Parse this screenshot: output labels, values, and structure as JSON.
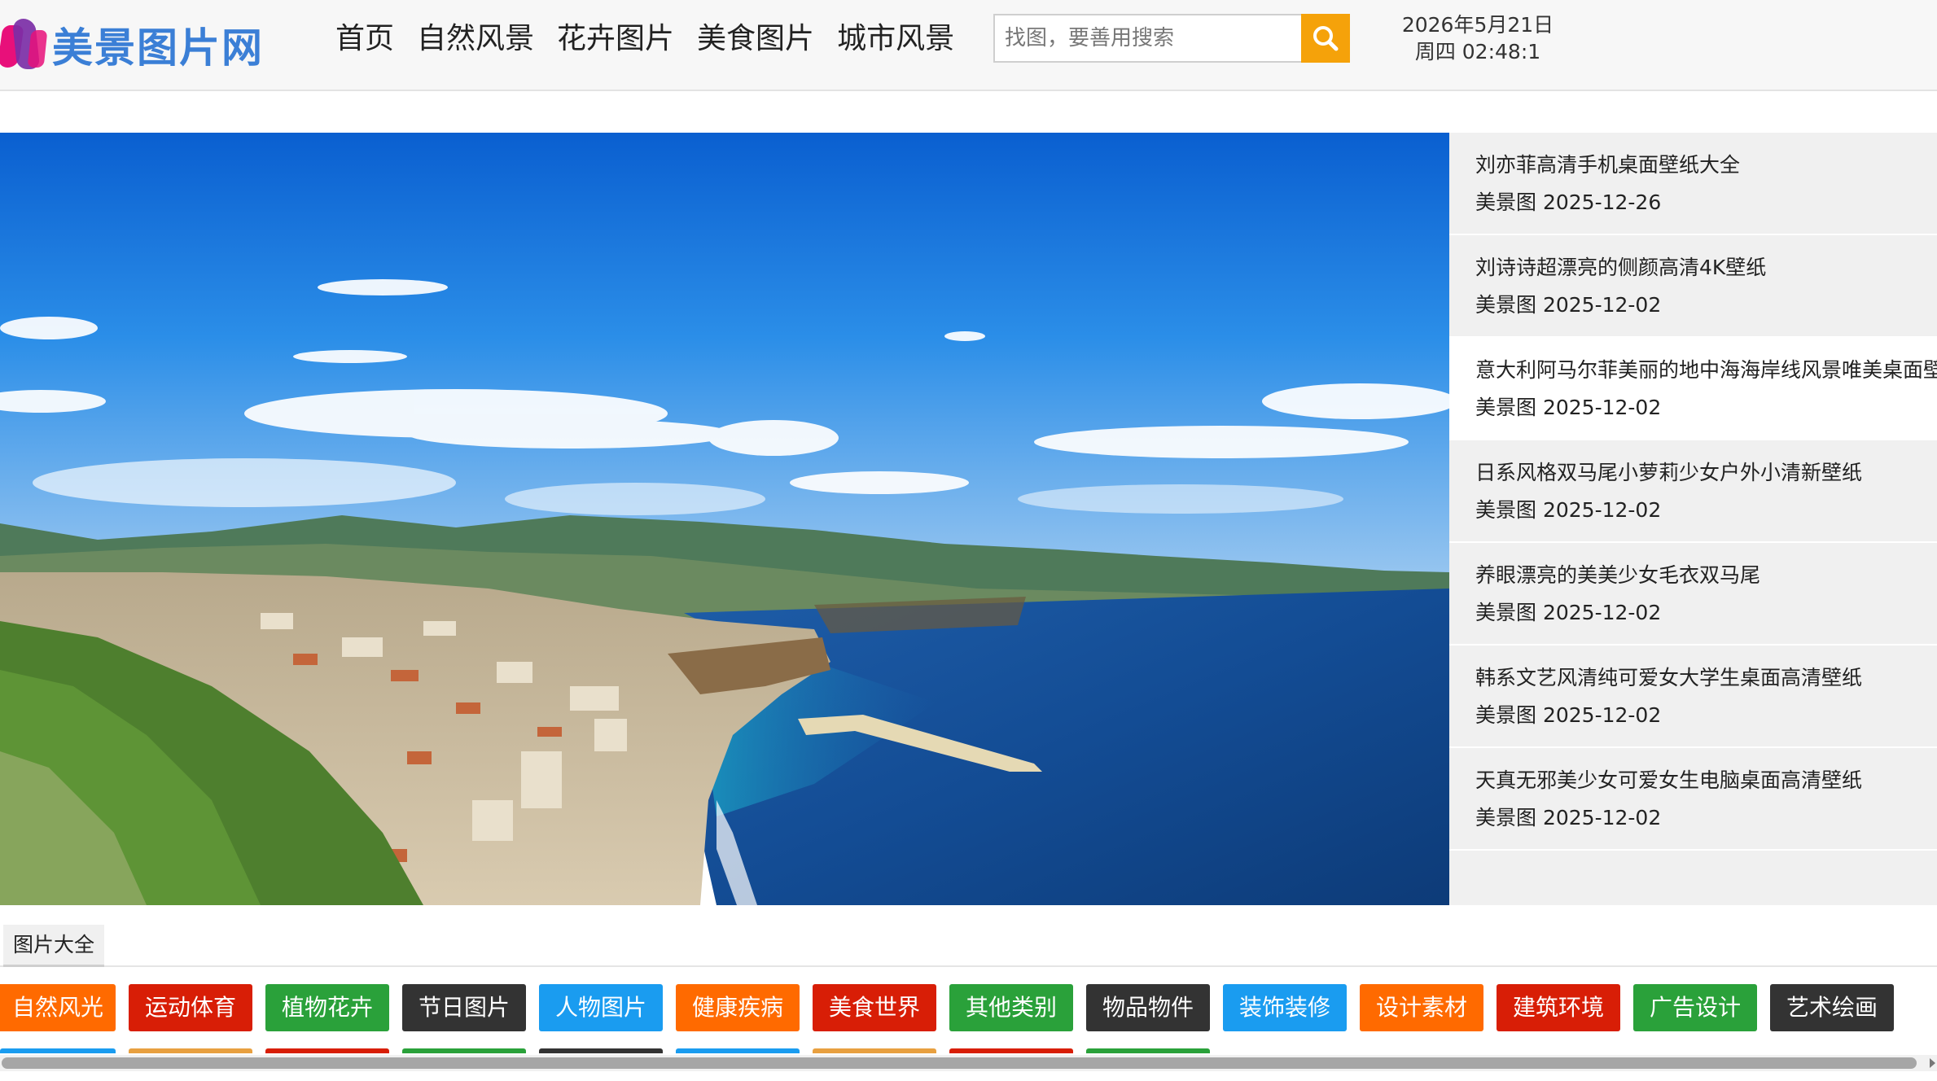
{
  "header": {
    "logo_text": "美景图片网",
    "nav": [
      {
        "label": "首页"
      },
      {
        "label": "自然风景"
      },
      {
        "label": "花卉图片"
      },
      {
        "label": "美食图片"
      },
      {
        "label": "城市风景"
      }
    ],
    "search": {
      "placeholder": "找图，要善用搜索",
      "button_icon": "search-icon",
      "button_color": "#f5a20a"
    },
    "datetime": {
      "date": "2026年5月21日",
      "time": "周四 02:48:1"
    }
  },
  "side_list": {
    "items": [
      {
        "title": "刘亦菲高清手机桌面壁纸大全",
        "meta": "美景图 2025-12-26"
      },
      {
        "title": "刘诗诗超漂亮的侧颜高清4K壁纸",
        "meta": "美景图 2025-12-02"
      },
      {
        "title": "意大利阿马尔菲美丽的地中海海岸线风景唯美桌面壁",
        "meta": "美景图 2025-12-02"
      },
      {
        "title": "日系风格双马尾小萝莉少女户外小清新壁纸",
        "meta": "美景图 2025-12-02"
      },
      {
        "title": "养眼漂亮的美美少女毛衣双马尾",
        "meta": "美景图 2025-12-02"
      },
      {
        "title": "韩系文艺风清纯可爱女大学生桌面高清壁纸",
        "meta": "美景图 2025-12-02"
      },
      {
        "title": "天真无邪美少女可爱女生电脑桌面高清壁纸",
        "meta": "美景图 2025-12-02"
      }
    ]
  },
  "section": {
    "tab_label": "图片大全"
  },
  "categories": [
    {
      "label": "自然风光",
      "color": "#ff6a00"
    },
    {
      "label": "运动体育",
      "color": "#d81e06"
    },
    {
      "label": "植物花卉",
      "color": "#2aa13a"
    },
    {
      "label": "节日图片",
      "color": "#333333"
    },
    {
      "label": "人物图片",
      "color": "#1a9cf0"
    },
    {
      "label": "健康疾病",
      "color": "#ff6a00"
    },
    {
      "label": "美食世界",
      "color": "#d81e06"
    },
    {
      "label": "其他类别",
      "color": "#2aa13a"
    },
    {
      "label": "物品物件",
      "color": "#333333"
    },
    {
      "label": "装饰装修",
      "color": "#1a9cf0"
    },
    {
      "label": "设计素材",
      "color": "#ff6a00"
    },
    {
      "label": "建筑环境",
      "color": "#d81e06"
    },
    {
      "label": "广告设计",
      "color": "#2aa13a"
    },
    {
      "label": "艺术绘画",
      "color": "#333333"
    }
  ],
  "categories_row2_colors": [
    "#1a9cf0",
    "#e8a040",
    "#d81e06",
    "#2aa13a",
    "#333333",
    "#1a9cf0",
    "#e8a040",
    "#d81e06",
    "#2aa13a"
  ]
}
